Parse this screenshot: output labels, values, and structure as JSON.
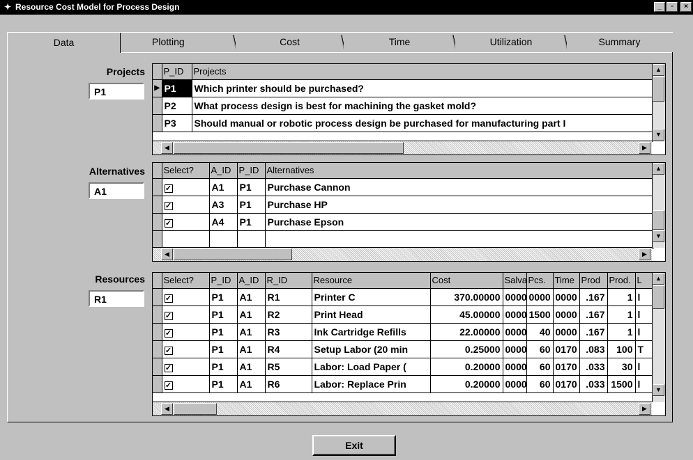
{
  "window": {
    "title": "Resource Cost Model for Process Design",
    "buttons": [
      "_",
      "▫",
      "×"
    ]
  },
  "tabs": [
    {
      "label": "Data",
      "active": true
    },
    {
      "label": "Plotting"
    },
    {
      "label": "Cost"
    },
    {
      "label": "Time"
    },
    {
      "label": "Utilization"
    },
    {
      "label": "Summary"
    }
  ],
  "projects": {
    "label": "Projects",
    "current": "P1",
    "columns": [
      "P_ID",
      "Projects"
    ],
    "rows": [
      [
        "P1",
        "Which printer should be purchased?"
      ],
      [
        "P2",
        "What process design is best for machining the gasket mold?"
      ],
      [
        "P3",
        "Should manual or robotic process design be purchased for manufacturing part I"
      ]
    ]
  },
  "alternatives": {
    "label": "Alternatives",
    "current": "A1",
    "columns": [
      "Select?",
      "A_ID",
      "P_ID",
      "Alternatives"
    ],
    "rows": [
      [
        "✓",
        "A1",
        "P1",
        "Purchase Cannon"
      ],
      [
        "✓",
        "A3",
        "P1",
        "Purchase HP"
      ],
      [
        "✓",
        "A4",
        "P1",
        "Purchase Epson"
      ]
    ]
  },
  "resources": {
    "label": "Resources",
    "current": "R1",
    "columns": [
      "Select?",
      "P_ID",
      "A_ID",
      "R_ID",
      "Resource",
      "Cost",
      "Salva",
      "Pcs.",
      "Time",
      "Prod",
      "Prod.",
      "L"
    ],
    "rows": [
      [
        "✓",
        "P1",
        "A1",
        "R1",
        "Printer C",
        "370.00000",
        "0000",
        "0000",
        "0000",
        ".167",
        "1",
        "l"
      ],
      [
        "✓",
        "P1",
        "A1",
        "R2",
        "Print Head",
        "45.00000",
        "0000",
        "1500",
        "0000",
        ".167",
        "1",
        "l"
      ],
      [
        "✓",
        "P1",
        "A1",
        "R3",
        "Ink Cartridge Refills",
        "22.00000",
        "0000",
        "40",
        "0000",
        ".167",
        "1",
        "l"
      ],
      [
        "✓",
        "P1",
        "A1",
        "R4",
        "Setup Labor (20 min",
        "0.25000",
        "0000",
        "60",
        "0170",
        ".083",
        "100",
        "T"
      ],
      [
        "✓",
        "P1",
        "A1",
        "R5",
        "Labor: Load Paper (",
        "0.20000",
        "0000",
        "60",
        "0170",
        ".033",
        "30",
        "l"
      ],
      [
        "✓",
        "P1",
        "A1",
        "R6",
        "Labor: Replace Prin",
        "0.20000",
        "0000",
        "60",
        "0170",
        ".033",
        "1500",
        "l"
      ]
    ]
  },
  "exit_label": "Exit"
}
